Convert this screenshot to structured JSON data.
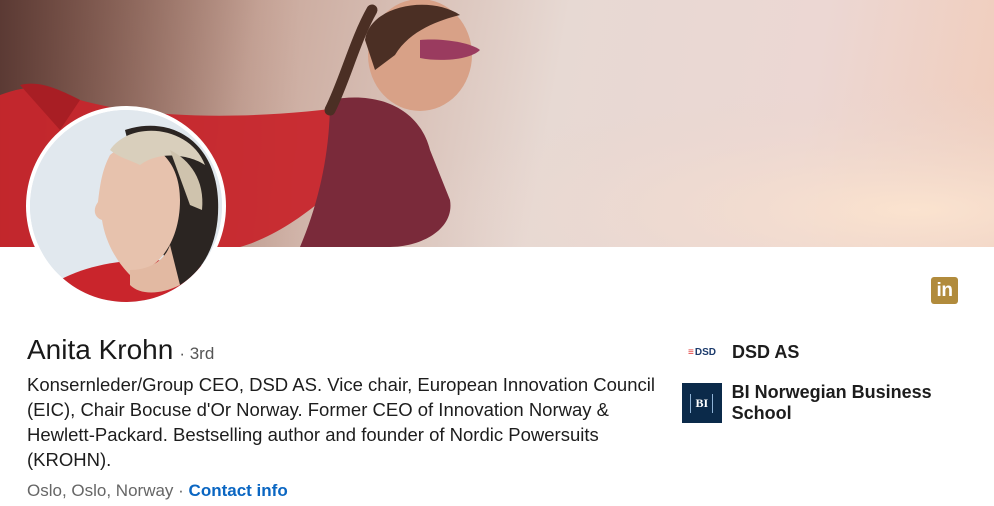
{
  "profile": {
    "name": "Anita Krohn",
    "degree": "· 3rd",
    "headline": "Konsernleder/Group CEO, DSD AS. Vice chair, European Innovation Council (EIC), Chair Bocuse d'Or Norway. Former CEO of Innovation Norway & Hewlett-Packard. Bestselling author and founder of Nordic Powersuits (KROHN).",
    "location": "Oslo, Oslo, Norway",
    "separator": " · ",
    "contact_info": "Contact info"
  },
  "linkedin_badge": {
    "label": "in",
    "color": "#b18b3c"
  },
  "organizations": [
    {
      "name": "DSD AS",
      "logo_text": "DSD",
      "logo_stripes": "≡"
    },
    {
      "name": "BI Norwegian Business School",
      "logo_text": "BI"
    }
  ],
  "images": {
    "cover": "cover-photo-girl-superhero",
    "avatar": "profile-photo"
  },
  "colors": {
    "link": "#0a66c2",
    "cape_red": "#c7262c"
  }
}
